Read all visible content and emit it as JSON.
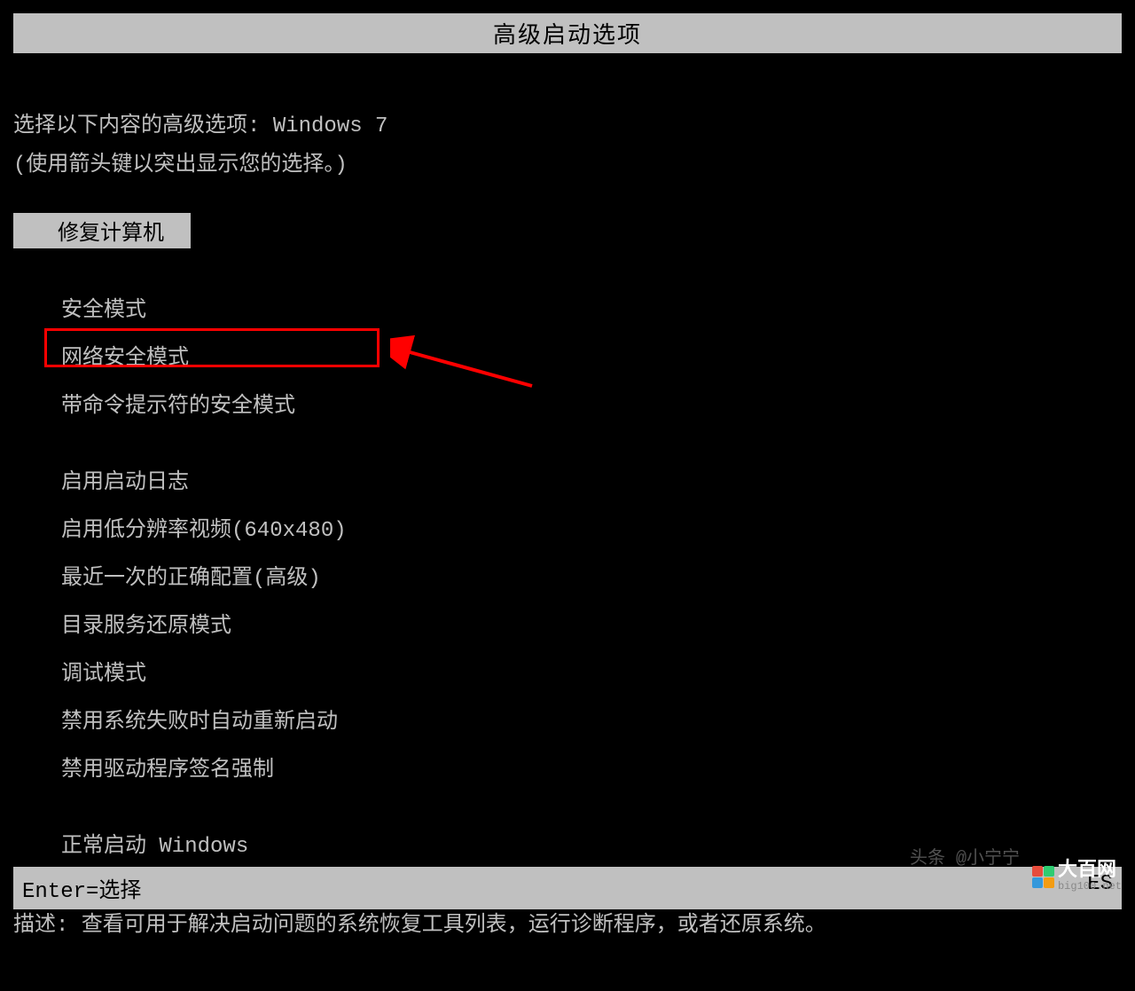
{
  "title": "高级启动选项",
  "prompt": {
    "prefix": "选择以下内容的高级选项: ",
    "os": "Windows 7"
  },
  "instruction": "(使用箭头键以突出显示您的选择。)",
  "options": {
    "repair": "修复计算机",
    "safe_mode": "安全模式",
    "safe_mode_network": "网络安全模式",
    "safe_mode_cmd": "带命令提示符的安全模式",
    "enable_boot_log": "启用启动日志",
    "enable_low_res": "启用低分辨率视频(640x480)",
    "last_known_good": "最近一次的正确配置(高级)",
    "directory_restore": "目录服务还原模式",
    "debug_mode": "调试模式",
    "disable_auto_restart": "禁用系统失败时自动重新启动",
    "disable_driver_sig": "禁用驱动程序签名强制",
    "start_normally": "正常启动 Windows"
  },
  "description": {
    "label": "描述: ",
    "text": "查看可用于解决启动问题的系统恢复工具列表，运行诊断程序，或者还原系统。"
  },
  "footer": {
    "enter": "Enter=选择",
    "esc": "ES"
  },
  "watermark": {
    "toutiao": "头条 @小宁宁",
    "logo_main": "大百网",
    "logo_sub": "big100.net"
  }
}
